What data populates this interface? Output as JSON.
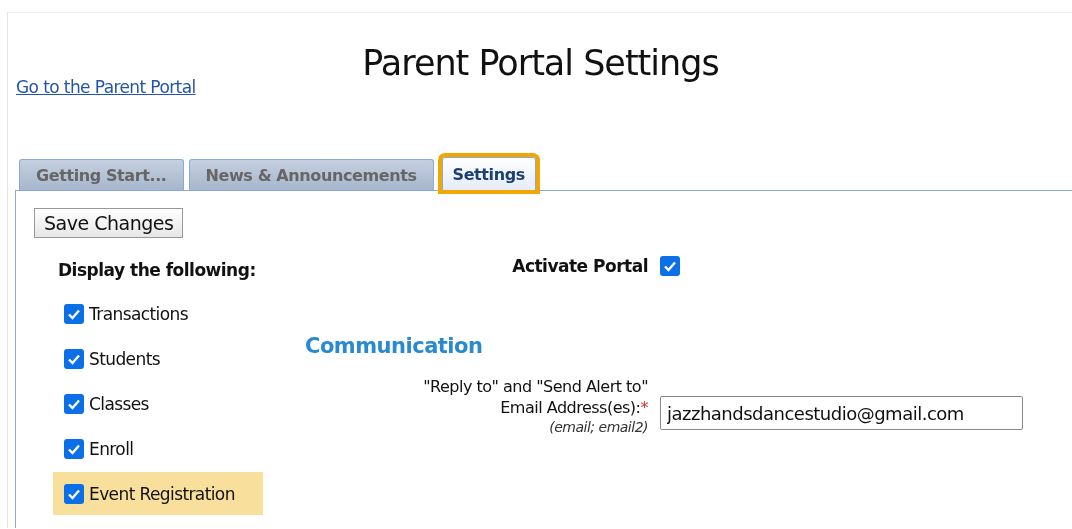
{
  "page": {
    "title": "Parent Portal Settings",
    "portal_link": "Go to the Parent Portal"
  },
  "tabs": [
    {
      "label": "Getting Start...",
      "selected": false,
      "highlighted": false
    },
    {
      "label": "News & Announcements",
      "selected": false,
      "highlighted": false
    },
    {
      "label": "Settings",
      "selected": true,
      "highlighted": true
    }
  ],
  "save_button": "Save Changes",
  "display": {
    "heading": "Display the following:",
    "items": [
      {
        "label": "Transactions",
        "checked": true,
        "highlighted": false
      },
      {
        "label": "Students",
        "checked": true,
        "highlighted": false
      },
      {
        "label": "Classes",
        "checked": true,
        "highlighted": false
      },
      {
        "label": "Enroll",
        "checked": true,
        "highlighted": false
      },
      {
        "label": "Event Registration",
        "checked": true,
        "highlighted": true
      }
    ]
  },
  "activate_portal": {
    "label": "Activate Portal",
    "checked": true
  },
  "communication": {
    "heading": "Communication",
    "email_label_line1": "\"Reply to\" and \"Send Alert to\"",
    "email_label_line2": "Email Address(es):",
    "required_mark": "*",
    "email_hint": "(email; email2)",
    "email_value": "jazzhandsdancestudio@gmail.com"
  }
}
